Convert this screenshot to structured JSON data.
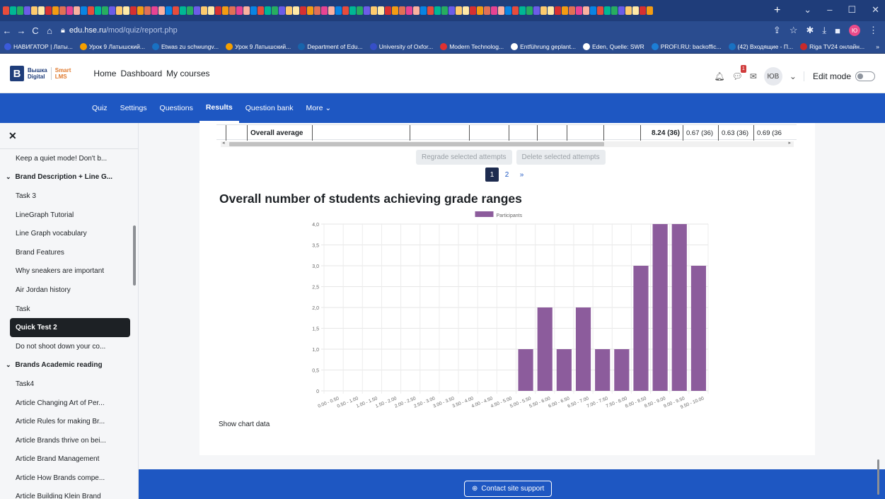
{
  "browser": {
    "url_host": "edu.hse.ru",
    "url_path": "/mod/quiz/report.php",
    "profile_initials": "Ю",
    "bookmarks": [
      "НАВИГАТОР | Латы...",
      "Урок 9 Латышский...",
      "Etwas zu schwungv...",
      "Урок 9 Латышский...",
      "Department of Edu...",
      "University of Oxfor...",
      "Modern Technolog...",
      "Entführung geplant...",
      "Eden, Quelle: SWR",
      "PROFI.RU: backoffic...",
      "(42) Входящие - П...",
      "Riga TV24 онлайн..."
    ]
  },
  "site": {
    "logo_line1": "Вышка",
    "logo_line2": "Digital",
    "logo_smart1": "Smart",
    "logo_smart2": "LMS",
    "nav": [
      "Home",
      "Dashboard",
      "My courses"
    ],
    "notification_count": "1",
    "user_initials": "ЮВ",
    "edit_mode_label": "Edit mode"
  },
  "secondary_nav": [
    "Quiz",
    "Settings",
    "Questions",
    "Results",
    "Question bank",
    "More"
  ],
  "secondary_active": "Results",
  "drawer": {
    "items": [
      {
        "label": "Keep a quiet mode! Don't b...",
        "type": "item"
      },
      {
        "label": "Brand Description + Line G...",
        "type": "section"
      },
      {
        "label": "Task 3",
        "type": "item"
      },
      {
        "label": "LineGraph Tutorial",
        "type": "item"
      },
      {
        "label": "Line Graph vocabulary",
        "type": "item"
      },
      {
        "label": "Brand Features",
        "type": "item"
      },
      {
        "label": "Why sneakers are important",
        "type": "item"
      },
      {
        "label": "Air Jordan history",
        "type": "item"
      },
      {
        "label": "Task",
        "type": "item"
      },
      {
        "label": "Quick Test 2",
        "type": "active"
      },
      {
        "label": "Do not shoot down your co...",
        "type": "item"
      },
      {
        "label": "Brands Academic reading",
        "type": "section"
      },
      {
        "label": "Task4",
        "type": "item"
      },
      {
        "label": "Article Changing Art of Per...",
        "type": "item"
      },
      {
        "label": "Article Rules for making Br...",
        "type": "item"
      },
      {
        "label": "Article Brands thrive on bei...",
        "type": "item"
      },
      {
        "label": "Article Brand Management",
        "type": "item"
      },
      {
        "label": "Article How Brands compe...",
        "type": "item"
      },
      {
        "label": "Article Building Klein Brand",
        "type": "item"
      }
    ]
  },
  "results_table": {
    "row_label": "Overall average",
    "overall_grade": "8.24 (36)",
    "q_values": [
      "0.67 (36)",
      "0.63 (36)",
      "0.69 (36"
    ]
  },
  "actions": {
    "regrade": "Regrade selected attempts",
    "delete": "Delete selected attempts"
  },
  "pagination": {
    "pages": [
      "1",
      "2"
    ],
    "current": "1",
    "next": "»"
  },
  "chart_heading": "Overall number of students achieving grade ranges",
  "show_chart_data": "Show chart data",
  "footer": {
    "support": "Contact site support"
  },
  "chart_data": {
    "type": "bar",
    "title": "",
    "xlabel": "",
    "ylabel": "",
    "categories": [
      "0.00 - 0.50",
      "0.50 - 1.00",
      "1.00 - 1.50",
      "1.50 - 2.00",
      "2.00 - 2.50",
      "2.50 - 3.00",
      "3.00 - 3.50",
      "3.50 - 4.00",
      "4.00 - 4.50",
      "4.50 - 5.00",
      "5.00 - 5.50",
      "5.50 - 6.00",
      "6.00 - 6.50",
      "6.50 - 7.00",
      "7.00 - 7.50",
      "7.50 - 8.00",
      "8.00 - 8.50",
      "8.50 - 9.00",
      "9.00 - 9.50",
      "9.50 - 10.00"
    ],
    "series": [
      {
        "name": "Participants",
        "values": [
          0,
          0,
          0,
          0,
          0,
          0,
          0,
          0,
          0,
          0,
          1,
          2,
          1,
          2,
          1,
          1,
          3,
          4,
          4,
          3
        ],
        "color": "#8c5c9c"
      }
    ],
    "ylim": [
      0,
      4
    ],
    "yticks": [
      "0",
      "0,5",
      "1,0",
      "1,5",
      "2,0",
      "2,5",
      "3,0",
      "3,5",
      "4,0"
    ],
    "grid": true,
    "legend": "top"
  }
}
